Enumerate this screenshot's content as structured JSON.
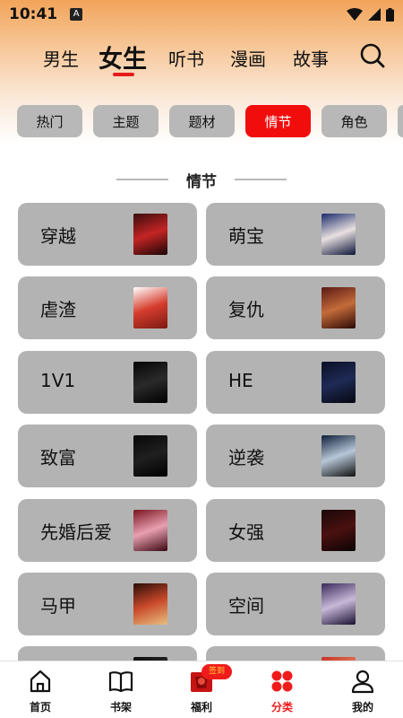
{
  "status_bar": {
    "time": "10:41",
    "notification_badge": "A",
    "icons": [
      "wifi-icon",
      "signal-icon",
      "battery-icon"
    ]
  },
  "top_nav": {
    "tabs": [
      {
        "label": "男生",
        "active": false
      },
      {
        "label": "女生",
        "active": true
      },
      {
        "label": "听书",
        "active": false
      },
      {
        "label": "漫画",
        "active": false
      },
      {
        "label": "故事",
        "active": false
      }
    ],
    "search_icon": "search-icon",
    "accent_color": "#e51c1c"
  },
  "category_chips": [
    {
      "label": "热门",
      "active": false
    },
    {
      "label": "主题",
      "active": false
    },
    {
      "label": "题材",
      "active": false
    },
    {
      "label": "情节",
      "active": true
    },
    {
      "label": "角色",
      "active": false
    }
  ],
  "section": {
    "title": "情节"
  },
  "cards": [
    {
      "label": "穿越",
      "cover_colors": [
        "#3a0d0d",
        "#c42424",
        "#1a0606"
      ]
    },
    {
      "label": "萌宝",
      "cover_colors": [
        "#1b2a6b",
        "#e8e0e0",
        "#0b1437"
      ]
    },
    {
      "label": "虐渣",
      "cover_colors": [
        "#ffffff",
        "#d63d2e",
        "#7c1a12"
      ]
    },
    {
      "label": "复仇",
      "cover_colors": [
        "#5a1a14",
        "#c46b3a",
        "#2b0a06"
      ]
    },
    {
      "label": "1V1",
      "cover_colors": [
        "#050505",
        "#2a2a2a",
        "#000000"
      ]
    },
    {
      "label": "HE",
      "cover_colors": [
        "#0a0f26",
        "#1f2a55",
        "#05070f"
      ]
    },
    {
      "label": "致富",
      "cover_colors": [
        "#080808",
        "#1f1f1f",
        "#000000"
      ]
    },
    {
      "label": "逆袭",
      "cover_colors": [
        "#0d1f3a",
        "#b7c7d8",
        "#101010"
      ]
    },
    {
      "label": "先婚后爱",
      "cover_colors": [
        "#7a1420",
        "#e8a0b0",
        "#3b0610"
      ]
    },
    {
      "label": "女强",
      "cover_colors": [
        "#1a0808",
        "#4a1010",
        "#0a0303"
      ]
    },
    {
      "label": "马甲",
      "cover_colors": [
        "#2a0e08",
        "#c8482a",
        "#e8c080"
      ]
    },
    {
      "label": "空间",
      "cover_colors": [
        "#3a2a5a",
        "#c8b8d8",
        "#1a1030"
      ]
    },
    {
      "label": "",
      "cover_colors": [
        "#101010",
        "#303030",
        "#000000"
      ]
    },
    {
      "label": "",
      "cover_colors": [
        "#c83020",
        "#f0a080",
        "#702010"
      ]
    }
  ],
  "bottom_nav": {
    "items": [
      {
        "label": "首页",
        "icon": "home-icon",
        "active": false
      },
      {
        "label": "书架",
        "icon": "bookshelf-icon",
        "active": false
      },
      {
        "label": "福利",
        "icon": "gift-icon",
        "active": false,
        "badge": "签到"
      },
      {
        "label": "分类",
        "icon": "category-icon",
        "active": true
      },
      {
        "label": "我的",
        "icon": "profile-icon",
        "active": false
      }
    ],
    "active_color": "#f01c1c"
  }
}
